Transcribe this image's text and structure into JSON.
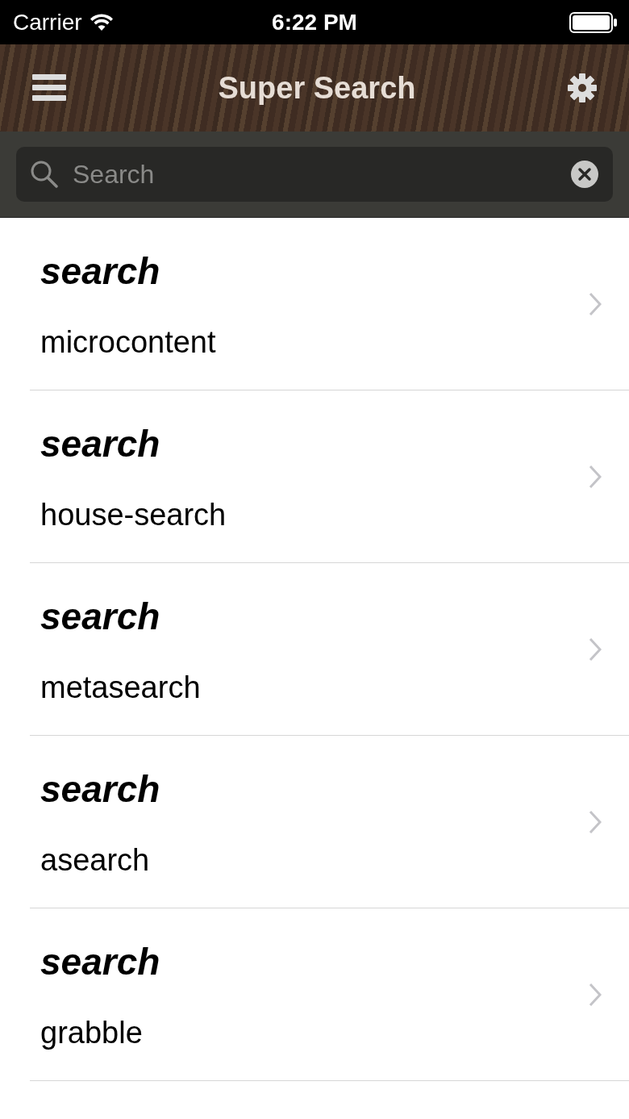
{
  "status_bar": {
    "carrier": "Carrier",
    "time": "6:22 PM"
  },
  "nav_bar": {
    "title": "Super Search"
  },
  "search": {
    "placeholder": "Search"
  },
  "results": [
    {
      "term": "search",
      "match": "microcontent"
    },
    {
      "term": "search",
      "match": "house-search"
    },
    {
      "term": "search",
      "match": "metasearch"
    },
    {
      "term": "search",
      "match": "asearch"
    },
    {
      "term": "search",
      "match": "grabble"
    }
  ]
}
